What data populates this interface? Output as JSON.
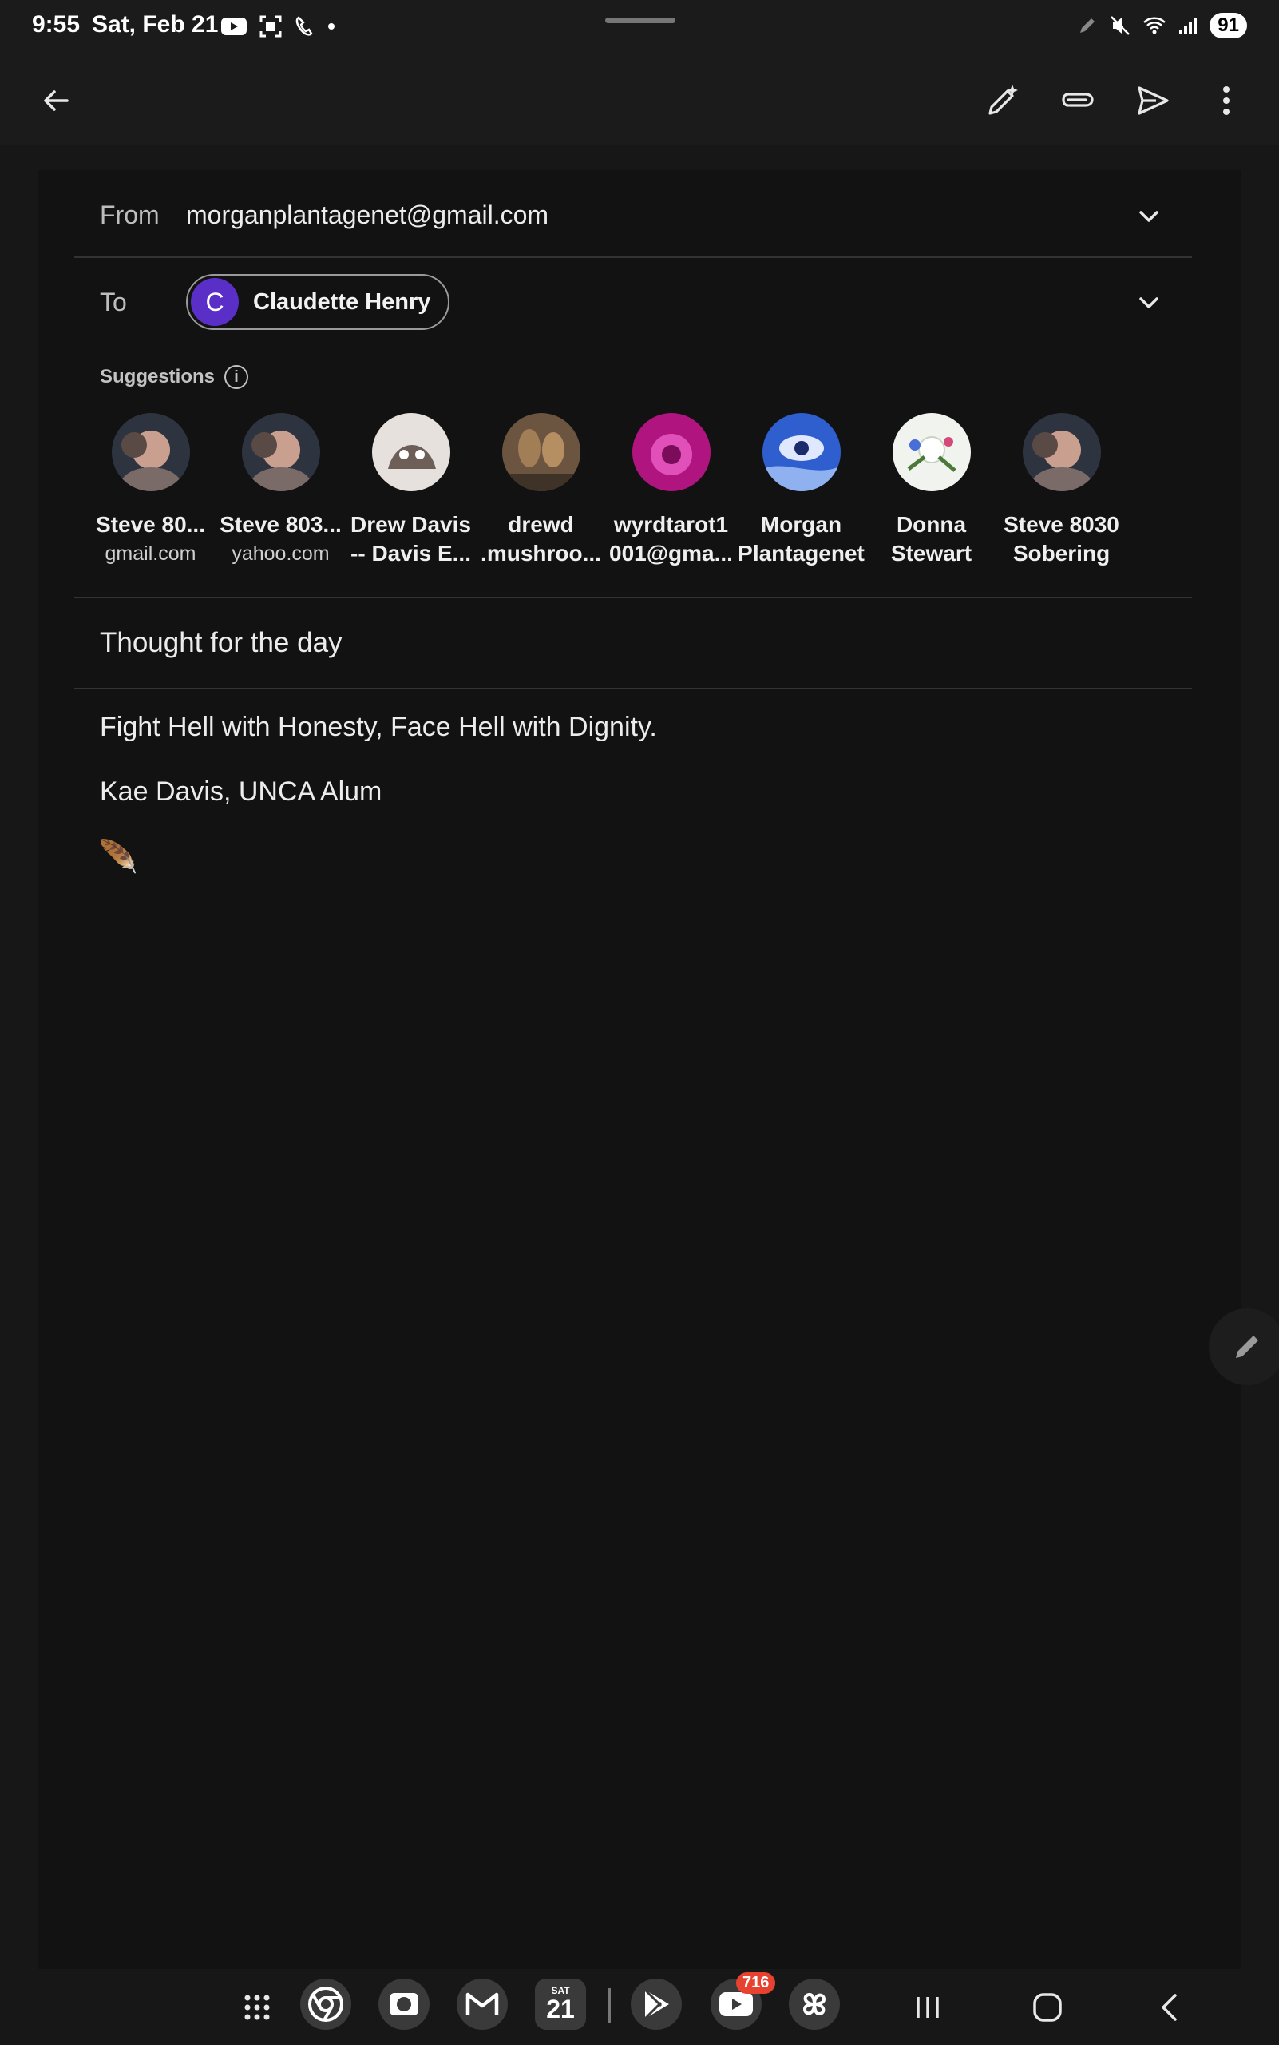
{
  "status_bar": {
    "time": "9:55",
    "date": "Sat, Feb 21",
    "battery": "91"
  },
  "app_bar": {
    "icons": [
      "back-arrow-icon",
      "magic-pen-icon",
      "attach-icon",
      "send-icon",
      "more-vert-icon"
    ]
  },
  "compose": {
    "from_label": "From",
    "from_value": "morganplantagenet@gmail.com",
    "to_label": "To",
    "recipient": {
      "initial": "C",
      "name": "Claudette Henry",
      "avatar_color": "#5a2fc8"
    },
    "suggestions_title": "Suggestions",
    "suggestions": [
      {
        "line1": "Steve 80...",
        "line2": "gmail.com",
        "bold2": false,
        "avatar_color": "#6b5a55"
      },
      {
        "line1": "Steve 803...",
        "line2": "yahoo.com",
        "bold2": false,
        "avatar_color": "#6b5a55"
      },
      {
        "line1": "Drew Davis",
        "line2": "-- Davis E...",
        "bold2": true,
        "avatar_color": "#d9d3cf"
      },
      {
        "line1": "drewd",
        "line2": ".mushroo...",
        "bold2": true,
        "avatar_color": "#8a6a48"
      },
      {
        "line1": "wyrdtarot1",
        "line2": "001@gma...",
        "bold2": true,
        "avatar_color": "#c0198f"
      },
      {
        "line1": "Morgan",
        "line2": "Plantagenet",
        "bold2": true,
        "avatar_color": "#3b6fd6"
      },
      {
        "line1": "Donna",
        "line2": "Stewart",
        "bold2": true,
        "avatar_color": "#e8eee6"
      },
      {
        "line1": "Steve 8030",
        "line2": "Sobering",
        "bold2": true,
        "avatar_color": "#6b5a55"
      }
    ],
    "subject": "Thought for the day",
    "body_line1": "Fight Hell with Honesty, Face Hell with Dignity.",
    "body_line2": "Kae Davis, UNCA Alum",
    "body_emoji": "🪶"
  },
  "taskbar": {
    "apps": [
      "apps-grid-icon",
      "chrome-icon",
      "camera-icon",
      "gmail-icon",
      "calendar-icon",
      "play-store-icon",
      "youtube-icon",
      "pinwheel-icon"
    ],
    "calendar_day": "21",
    "calendar_weekday": "SAT",
    "youtube_badge": "716"
  }
}
